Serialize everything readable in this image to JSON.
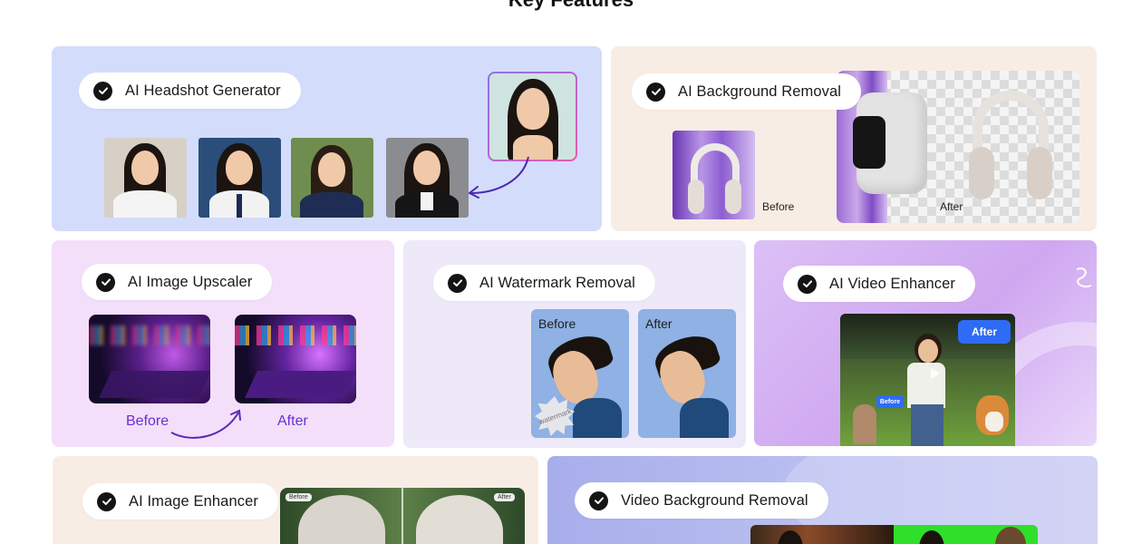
{
  "section": {
    "title": "Key Features"
  },
  "features": {
    "headshot": {
      "label": "AI Headshot Generator"
    },
    "background_removal": {
      "label": "AI Background Removal",
      "before": "Before",
      "after": "After"
    },
    "upscaler": {
      "label": "AI Image Upscaler",
      "before": "Before",
      "after": "After"
    },
    "watermark": {
      "label": "AI Watermark Removal",
      "before": "Before",
      "after": "After",
      "stamp": "watermark"
    },
    "video_enhancer": {
      "label": "AI Video Enhancer",
      "after_badge": "After",
      "before_badge": "Before"
    },
    "image_enhancer": {
      "label": "AI Image Enhancer",
      "before_badge": "Before",
      "after_badge": "After"
    },
    "video_bg_removal": {
      "label": "Video Background Removal"
    }
  },
  "colors": {
    "headshot_bg": "#d4dcfb",
    "bg_removal_bg": "#f8ede5",
    "upscaler_bg": "#f3dffa",
    "watermark_bg": "#ede9f8",
    "video_enhancer_bg": "#d8b4f2",
    "image_enhancer_bg": "#f8ede5",
    "video_bg_removal_bg": "#aeb4ec",
    "accent_purple": "#6b2fd0",
    "badge_blue": "#2f6cf5"
  },
  "icons": [
    "check-icon",
    "curved-arrow-icon",
    "play-icon"
  ]
}
